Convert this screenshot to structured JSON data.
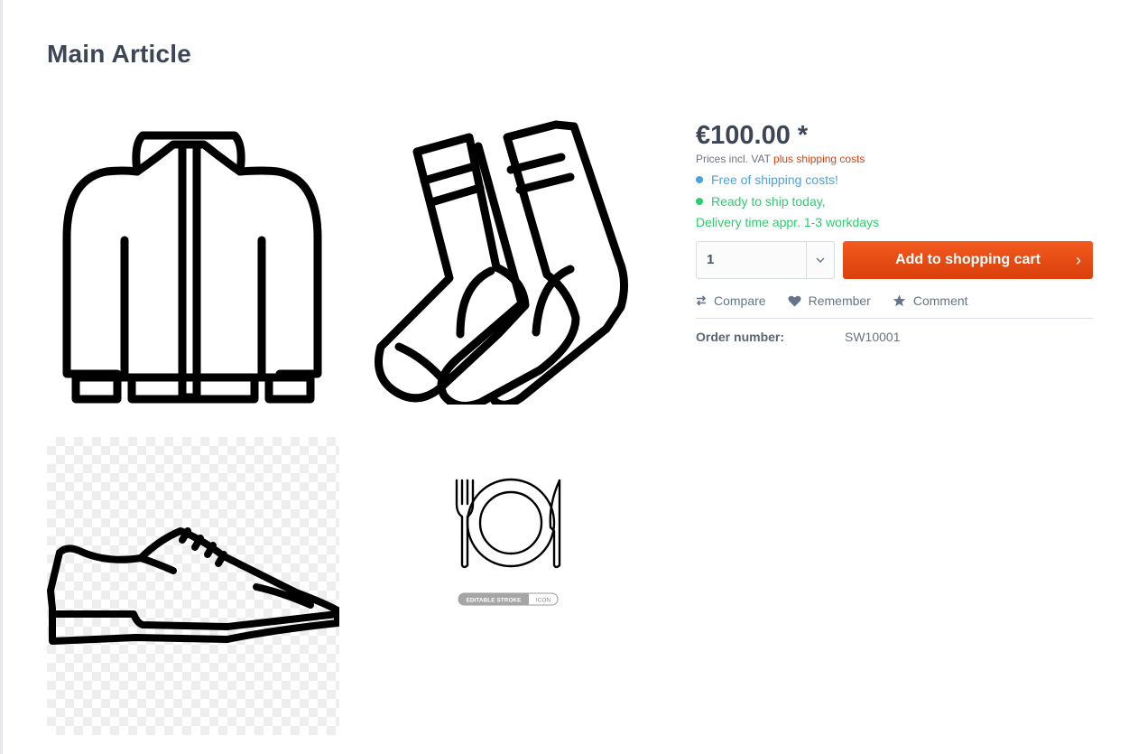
{
  "page": {
    "title": "Main Article"
  },
  "gallery": {
    "images": [
      {
        "name": "jacket",
        "icon": "jacket-icon"
      },
      {
        "name": "socks",
        "icon": "socks-icon"
      },
      {
        "name": "shoe",
        "icon": "shoe-icon"
      },
      {
        "name": "plate-cutlery",
        "icon": "plate-cutlery-icon",
        "badge_left": "EDITABLE STROKE",
        "badge_right": "ICON"
      }
    ]
  },
  "buybox": {
    "price": "€100.00 *",
    "vat_prefix": "Prices incl. VAT ",
    "shipping_link": "plus shipping costs",
    "free_shipping": "Free of shipping costs!",
    "ready": "Ready to ship today,",
    "delivery": "Delivery time appr. 1-3 workdays",
    "quantity": "1",
    "add_to_cart": "Add to shopping cart",
    "actions": {
      "compare": "Compare",
      "remember": "Remember",
      "comment": "Comment"
    },
    "order_label": "Order number:",
    "order_number": "SW10001"
  },
  "colors": {
    "accent": "#d9400b",
    "free_shipping": "#4aa3df",
    "ready": "#2ecc71",
    "title": "#3c4655"
  }
}
